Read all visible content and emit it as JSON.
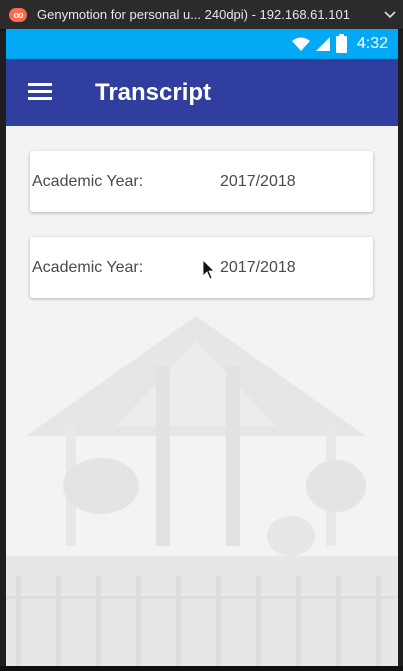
{
  "window": {
    "title": "Genymotion for personal u... 240dpi) - 192.168.61.101",
    "logo_text": "oo",
    "logo_icon": "genymotion-logo-icon",
    "menu_icon": "chevron-down-icon"
  },
  "statusbar": {
    "time": "4:32",
    "icons": [
      "wifi-icon",
      "signal-icon",
      "battery-icon"
    ],
    "color": "#03a9f4"
  },
  "appbar": {
    "title": "Transcript",
    "menu_icon": "hamburger-menu-icon",
    "color": "#303f9f"
  },
  "cards": [
    {
      "label": "Academic Year:",
      "value": "2017/2018"
    },
    {
      "label": "Academic Year:",
      "value": "2017/2018"
    }
  ]
}
